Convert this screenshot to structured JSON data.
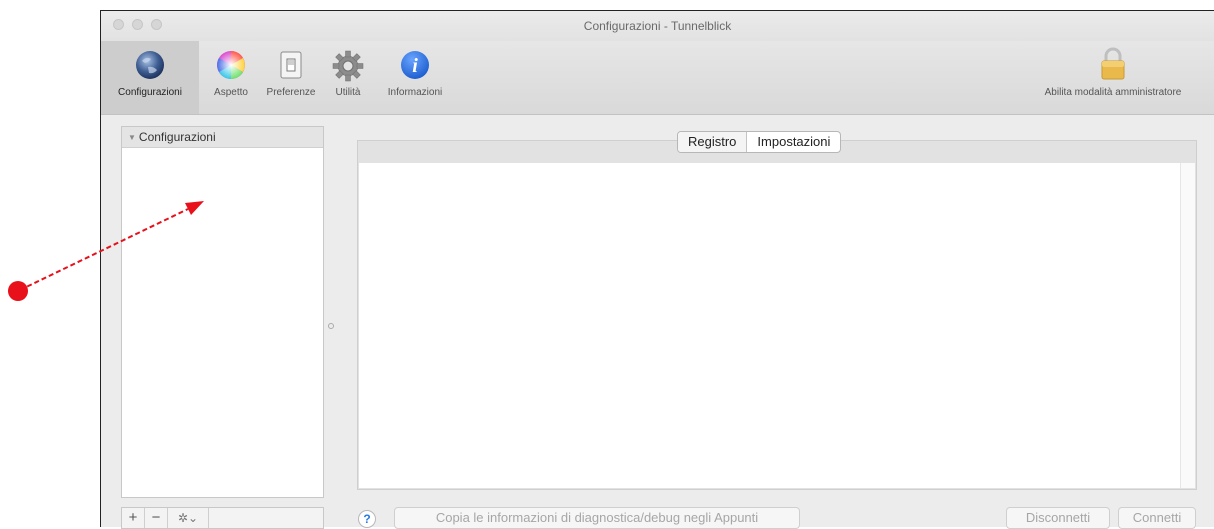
{
  "window": {
    "title": "Configurazioni - Tunnelblick"
  },
  "toolbar": {
    "items": [
      {
        "label": "Configurazioni",
        "icon": "globe-icon"
      },
      {
        "label": "Aspetto",
        "icon": "color-wheel-icon"
      },
      {
        "label": "Preferenze",
        "icon": "light-switch-icon"
      },
      {
        "label": "Utilità",
        "icon": "gear-icon"
      },
      {
        "label": "Informazioni",
        "icon": "info-icon"
      }
    ],
    "admin_label": "Abilita modalità amministratore",
    "admin_icon": "lock-icon"
  },
  "sidebar": {
    "header": "Configurazioni",
    "add_symbol": "+",
    "remove_symbol": "−",
    "action_symbol": "✲⌄"
  },
  "tabs": [
    {
      "label": "Registro"
    },
    {
      "label": "Impostazioni"
    }
  ],
  "footer": {
    "help_symbol": "?",
    "copy_diagnostics": "Copia le informazioni di diagnostica/debug negli Appunti",
    "disconnect": "Disconnetti",
    "connect": "Connetti"
  },
  "colors": {
    "annotation": "#e8101a",
    "help_blue": "#2b78e4",
    "info_blue": "#1f6fe0"
  }
}
